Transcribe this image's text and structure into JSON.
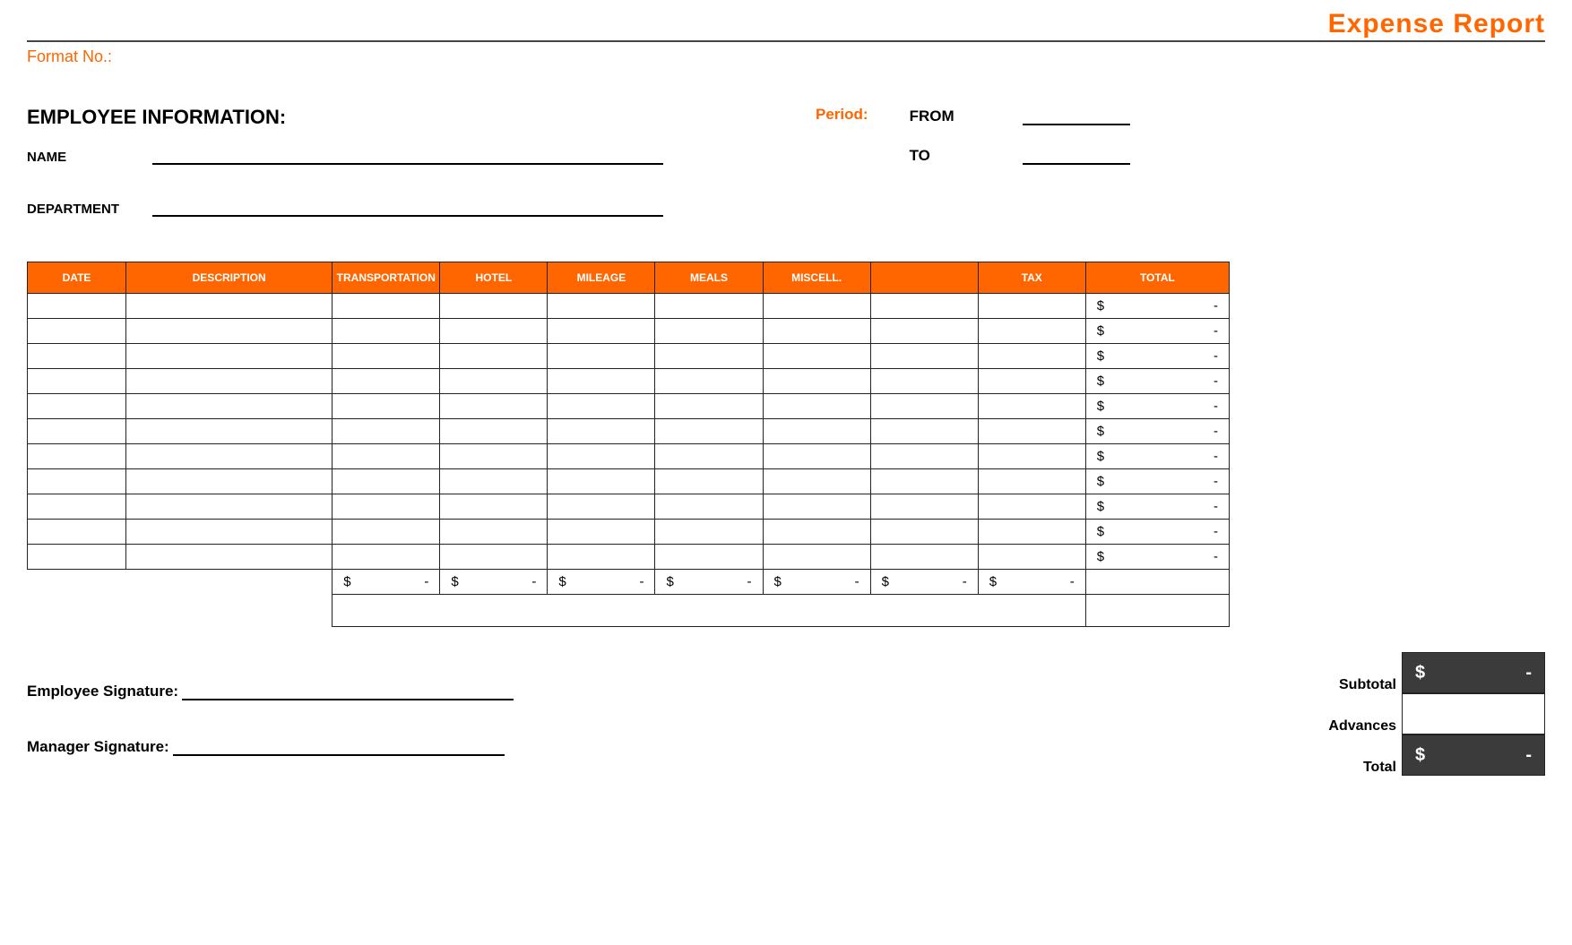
{
  "title": "Expense Report",
  "format_no_label": "Format No.:",
  "employee_info_heading": "EMPLOYEE INFORMATION:",
  "name_label": "NAME",
  "department_label": "DEPARTMENT",
  "period_label": "Period:",
  "from_label": "FROM",
  "to_label": "TO",
  "columns": {
    "date": "DATE",
    "description": "DESCRIPTION",
    "transportation": "TRANSPORTATION",
    "hotel": "HOTEL",
    "mileage": "MILEAGE",
    "meals": "MEALS",
    "miscell": "MISCELL.",
    "blank": "",
    "tax": "TAX",
    "total": "TOTAL"
  },
  "currency_symbol": "$",
  "dash": "-",
  "row_count": 11,
  "column_totals": {
    "transportation": "-",
    "hotel": "-",
    "mileage": "-",
    "meals": "-",
    "miscell": "-",
    "blank": "-",
    "tax": "-"
  },
  "summary": {
    "subtotal_label": "Subtotal",
    "subtotal_value": "-",
    "advances_label": "Advances",
    "advances_value": "",
    "total_label": "Total",
    "total_value": "-"
  },
  "employee_signature_label": "Employee Signature:",
  "manager_signature_label": "Manager Signature:"
}
